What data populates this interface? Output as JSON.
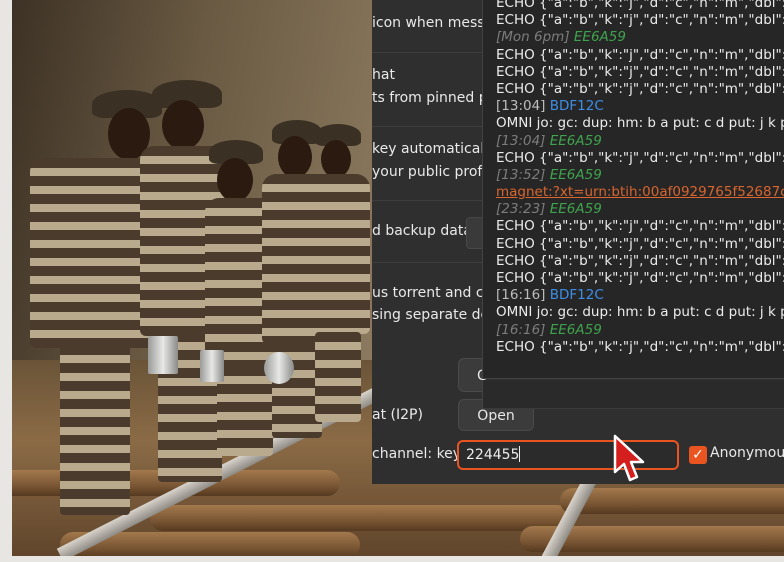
{
  "settings": {
    "partial_lines": [
      "icon when messa",
      "hat",
      "ts from pinned pa",
      "key automatically",
      "your public prof",
      "d backup data",
      "us torrent and ch",
      "sing separate de",
      "at (I2P)",
      "channel: key"
    ],
    "open_button_label": "Open",
    "stub_button_label": "C",
    "channel_key_value": "224455",
    "anonymous_label": "Anonymous"
  },
  "chat_log": {
    "lines": [
      {
        "kind": "echo",
        "text": "ECHO {\"a\":\"b\",\"k\":\"j\",\"d\":\"c\",\"n\":\"m\",\"dbl\":\""
      },
      {
        "kind": "echo",
        "text": "ECHO {\"a\":\"b\",\"k\":\"j\",\"d\":\"c\",\"n\":\"m\",\"dbl\":\"1"
      },
      {
        "kind": "ts_green",
        "time": "[Mon 6pm]",
        "id": "EE6A59"
      },
      {
        "kind": "echo",
        "text": "ECHO {\"a\":\"b\",\"k\":\"j\",\"d\":\"c\",\"n\":\"m\",\"dbl\":\"3"
      },
      {
        "kind": "echo",
        "text": "ECHO {\"a\":\"b\",\"k\":\"j\",\"d\":\"c\",\"n\":\"m\",\"dbl\":\"3"
      },
      {
        "kind": "echo",
        "text": "ECHO {\"a\":\"b\",\"k\":\"j\",\"d\":\"c\",\"n\":\"m\",\"dbl\":\"3"
      },
      {
        "kind": "ts_blue",
        "time": "[13:04]",
        "id": "BDF12C"
      },
      {
        "kind": "omni",
        "text": "OMNI jo: gc: dup: hm: b a put: c d put: j k pu"
      },
      {
        "kind": "ts_green",
        "time": "[13:04]",
        "id": "EE6A59"
      },
      {
        "kind": "echo",
        "text": "ECHO {\"a\":\"b\",\"k\":\"j\",\"d\":\"c\",\"n\":\"m\",\"dbl\":\"2"
      },
      {
        "kind": "ts_green",
        "time": "[13:52]",
        "id": "EE6A59"
      },
      {
        "kind": "magnet",
        "text": "magnet:?xt=urn:btih:00af0929765f52687c8"
      },
      {
        "kind": "ts_green",
        "time": "[23:23]",
        "id": "EE6A59"
      },
      {
        "kind": "echo",
        "text": "ECHO {\"a\":\"b\",\"k\":\"j\",\"d\":\"c\",\"n\":\"m\",\"dbl\":\"3"
      },
      {
        "kind": "echo",
        "text": "ECHO {\"a\":\"b\",\"k\":\"j\",\"d\":\"c\",\"n\":\"m\",\"dbl\":\"3"
      },
      {
        "kind": "echo",
        "text": "ECHO {\"a\":\"b\",\"k\":\"j\",\"d\":\"c\",\"n\":\"m\",\"dbl\":\"3"
      },
      {
        "kind": "echo",
        "text": "ECHO {\"a\":\"b\",\"k\":\"j\",\"d\":\"c\",\"n\":\"m\",\"dbl\":\"2"
      },
      {
        "kind": "ts_blue",
        "time": "[16:16]",
        "id": "BDF12C"
      },
      {
        "kind": "omni",
        "text": "OMNI jo: gc: dup: hm: b a put: c d put: j k pu"
      },
      {
        "kind": "ts_green",
        "time": "[16:16]",
        "id": "EE6A59"
      },
      {
        "kind": "echo",
        "text": "ECHO {\"a\":\"b\",\"k\":\"j\",\"d\":\"c\",\"n\":\"m\",\"dbl\":\"2"
      }
    ]
  },
  "colors": {
    "accent": "#e95420",
    "green_id": "#3fa34d",
    "blue_id": "#3d8ee8",
    "magnet_link": "#d9652f",
    "panel_bg": "#2f2f2f",
    "log_bg": "#262626"
  },
  "icons": {
    "pointer": "mouse-pointer-icon",
    "checkbox": "checkmark-icon"
  }
}
